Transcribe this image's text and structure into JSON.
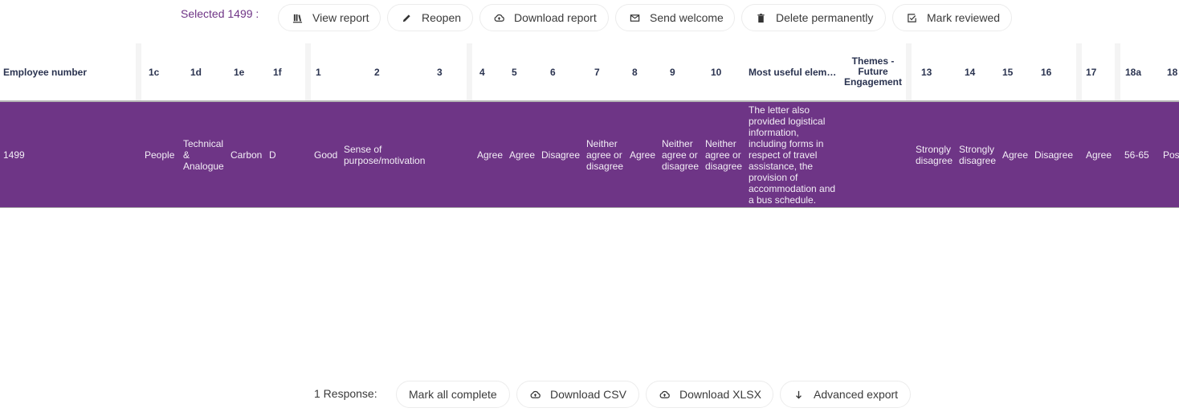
{
  "toolbar": {
    "selected_label": "Selected 1499 :",
    "buttons": [
      {
        "label": "View report",
        "icon": "library-icon"
      },
      {
        "label": "Reopen",
        "icon": "pencil-icon"
      },
      {
        "label": "Download report",
        "icon": "cloud-upload-icon"
      },
      {
        "label": "Send welcome",
        "icon": "envelope-icon"
      },
      {
        "label": "Delete permanently",
        "icon": "trash-icon"
      },
      {
        "label": "Mark reviewed",
        "icon": "checkbox-icon"
      }
    ]
  },
  "table": {
    "columns": [
      "Employee number",
      "1c",
      "1d",
      "1e",
      "1f",
      "1",
      "2",
      "3",
      "4",
      "5",
      "6",
      "7",
      "8",
      "9",
      "10",
      "Most useful elem…",
      "Themes - Future Engagement",
      "13",
      "14",
      "15",
      "16",
      "17",
      "18a",
      "18"
    ],
    "rows": [
      {
        "selected": true,
        "cells": [
          "1499",
          "People",
          "Technical & Analogue",
          "Carbon",
          "D",
          "Good",
          "Sense of purpose/motivation",
          "",
          "Agree",
          "Agree",
          "Disagree",
          "Neither agree or disagree",
          "Agree",
          "Neither agree or disagree",
          "Neither agree or disagree",
          "The letter also provided logistical information, including forms in respect of travel assistance, the provision of accommodation and a bus schedule.",
          "",
          "Strongly disagree",
          "Strongly disagree",
          "Agree",
          "Disagree",
          "Agree",
          "56-65",
          "Pos"
        ]
      }
    ]
  },
  "footer": {
    "response_label": "1 Response:",
    "buttons": [
      {
        "label": "Mark all complete",
        "icon": ""
      },
      {
        "label": "Download CSV",
        "icon": "cloud-upload-icon"
      },
      {
        "label": "Download XLSX",
        "icon": "cloud-upload-icon"
      },
      {
        "label": "Advanced export",
        "icon": "arrow-down-icon"
      }
    ]
  },
  "colors": {
    "accent": "#6e3586",
    "selected_label": "#6f3586",
    "header_text": "#2a3350"
  }
}
